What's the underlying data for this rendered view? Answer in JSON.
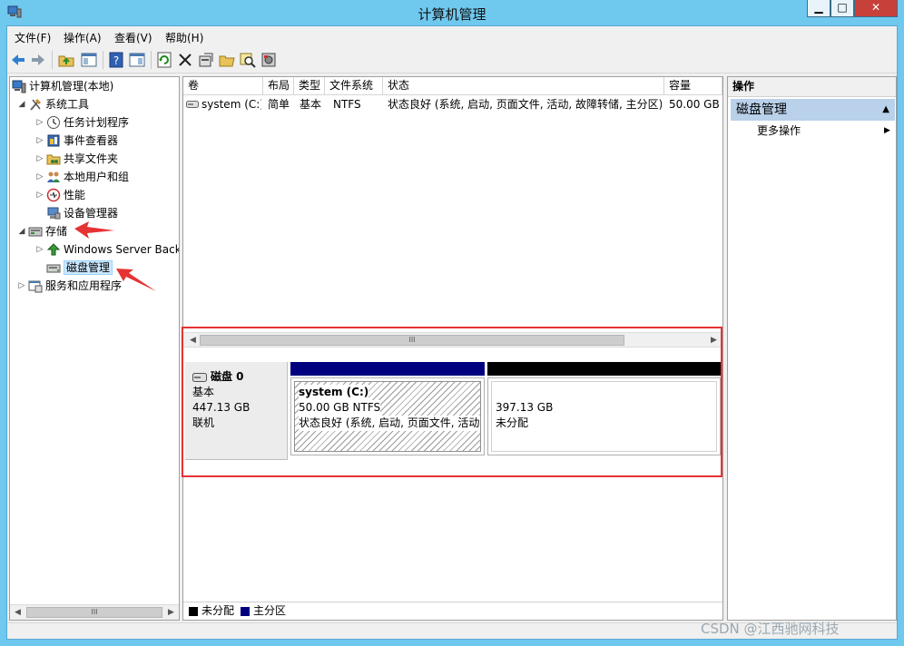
{
  "window": {
    "title": "计算机管理",
    "min_label": "▁",
    "max_label": "□",
    "close_label": "✕"
  },
  "menubar": [
    "文件(F)",
    "操作(A)",
    "查看(V)",
    "帮助(H)"
  ],
  "toolbar_icons": [
    "back-icon",
    "forward-icon",
    "up-folder-icon",
    "show-hide-tree-icon",
    "help-icon",
    "properties-icon",
    "refresh-icon",
    "delete-icon",
    "disk-properties-icon",
    "open-folder-icon",
    "search-icon",
    "disk-icon"
  ],
  "tree": {
    "root": "计算机管理(本地)",
    "system_tools": "系统工具",
    "task_scheduler": "任务计划程序",
    "event_viewer": "事件查看器",
    "shared_folders": "共享文件夹",
    "local_users": "本地用户和组",
    "performance": "性能",
    "device_manager": "设备管理器",
    "storage": "存储",
    "windows_backup": "Windows Server Back",
    "disk_management": "磁盘管理",
    "services_apps": "服务和应用程序"
  },
  "volume_table": {
    "columns": [
      "卷",
      "布局",
      "类型",
      "文件系统",
      "状态",
      "容量"
    ],
    "rows": [
      {
        "volume": "system (C:)",
        "layout": "简单",
        "type": "基本",
        "fs": "NTFS",
        "status": "状态良好 (系统, 启动, 页面文件, 活动, 故障转储, 主分区)",
        "capacity": "50.00 GB"
      }
    ]
  },
  "disk": {
    "name": "磁盘 0",
    "type": "基本",
    "size": "447.13 GB",
    "state": "联机",
    "partitions": [
      {
        "name": "system  (C:)",
        "size_fs": "50.00 GB NTFS",
        "status": "状态良好 (系统, 启动, 页面文件, 活动, 故障转储, 主分区)",
        "bar_color": "#00007f"
      },
      {
        "size": "397.13 GB",
        "status": "未分配",
        "bar_color": "#000000"
      }
    ]
  },
  "legend": [
    {
      "label": "未分配",
      "color": "#000000"
    },
    {
      "label": "主分区",
      "color": "#00007f"
    }
  ],
  "actions": {
    "header": "操作",
    "section": "磁盘管理",
    "more": "更多操作"
  },
  "scroll_glyph": "III",
  "watermark": "CSDN @江西驰网科技",
  "colors": {
    "title_bar": "#6fc8ee",
    "annotation_red": "#e53333",
    "selection": "#cce8ff"
  }
}
